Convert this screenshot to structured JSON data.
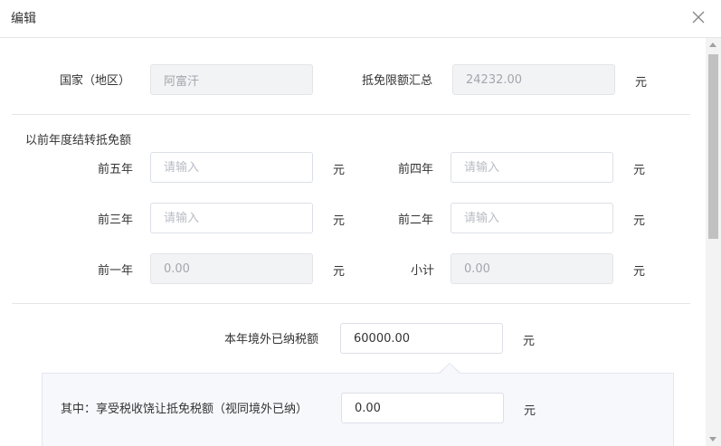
{
  "dialog": {
    "title": "编辑",
    "close_icon": "close-icon"
  },
  "country": {
    "label": "国家（地区）",
    "value": "阿富汗"
  },
  "limit_total": {
    "label": "抵免限额汇总",
    "value": "24232.00",
    "unit": "元"
  },
  "carryover": {
    "section_label": "以前年度结转抵免额",
    "fields": [
      {
        "label": "前五年",
        "placeholder": "请输入",
        "value": "",
        "unit": "元"
      },
      {
        "label": "前四年",
        "placeholder": "请输入",
        "value": "",
        "unit": "元"
      },
      {
        "label": "前三年",
        "placeholder": "请输入",
        "value": "",
        "unit": "元"
      },
      {
        "label": "前二年",
        "placeholder": "请输入",
        "value": "",
        "unit": "元"
      },
      {
        "label": "前一年",
        "placeholder": "",
        "value": "0.00",
        "unit": "元"
      },
      {
        "label": "小计",
        "placeholder": "",
        "value": "0.00",
        "unit": "元"
      }
    ]
  },
  "foreign_tax_paid": {
    "label": "本年境外已纳税额",
    "value": "60000.00",
    "unit": "元"
  },
  "tax_sparing": {
    "label": "其中：享受税收饶让抵免税额（视同境外已纳）",
    "value": "0.00",
    "unit": "元"
  }
}
